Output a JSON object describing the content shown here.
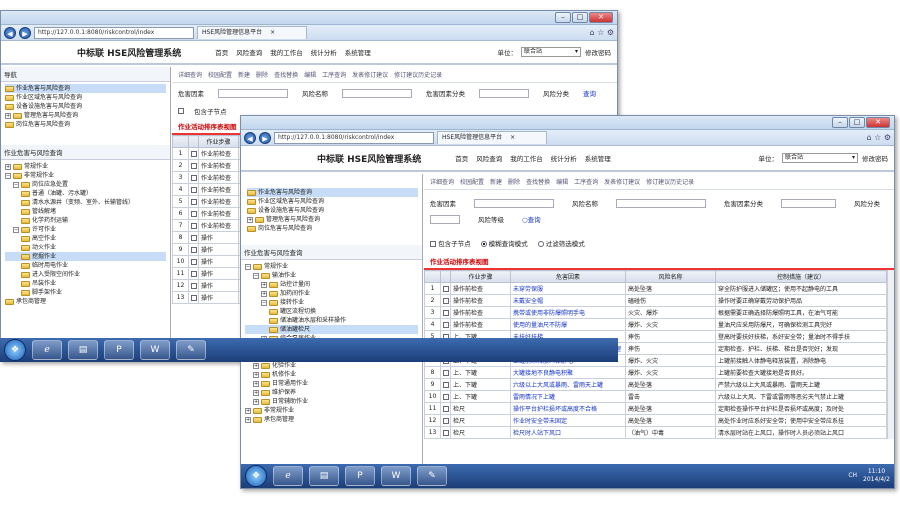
{
  "browser": {
    "url": "http://127.0.0.1:8080/riskcontrol/index",
    "tab_title": "HSE风险管理信息平台",
    "tab_close": "×"
  },
  "app": {
    "logo": "中标联 HSE风险管理系统",
    "menu": [
      "首页",
      "风险查询",
      "我的工作台",
      "统计分析",
      "系统管理"
    ],
    "unit_label": "单位：",
    "unit_value": "联合站",
    "change_pwd": "修改密码"
  },
  "left_header": "导航",
  "tree_top": [
    "作业危害与风险查询",
    "作业区域危害与风险查询",
    "设备设施危害与风险查询",
    "管理危害与风险查询",
    "岗位危害与风险查询"
  ],
  "back_tree": {
    "header": "作业危害与风险查询",
    "nodes": [
      "常规作业",
      "非常规作业",
      "岗位应急处置",
      "普通（油罐、污水罐）",
      "清水水源井（变频、室外、长输管线）",
      "管线解堵",
      "化学药剂运输",
      "许可作业",
      "高空作业",
      "动火作业",
      "挖掘作业",
      "临时用电作业",
      "进入受限空间作业",
      "吊装作业",
      "脚手架作业",
      "承包商管理"
    ]
  },
  "front_tree": {
    "header": "作业危害与风险查询",
    "nodes": [
      "常规作业",
      "输油作业",
      "站控计量间",
      "加药间作业",
      "接转作业",
      "罐区流程切换",
      "储油罐油水层和采样操作",
      "储油罐检尺",
      "综合泵房作业",
      "污水处理作业",
      "注水站作业",
      "化验作业",
      "机修作业",
      "日常通用作业",
      "维护保养",
      "日常辅助作业",
      "非常规作业",
      "承包商管理"
    ]
  },
  "toolbar": [
    "详细查询",
    "校园配置",
    "新建",
    "删除",
    "查找替换",
    "编辑",
    "工序查询",
    "发表修订建议",
    "修订建议历史记录"
  ],
  "form": {
    "f1": "危害因素",
    "f2": "风险名称",
    "f3": "危害因素分类",
    "f4": "风险分类",
    "f5": "风险等级",
    "query": "查询"
  },
  "opts": {
    "include_children": "包含子节点",
    "fuzzy": "模糊查询模式",
    "filter": "过滤筛选模式"
  },
  "section_title": "作业活动排序表视图",
  "table": {
    "headers": [
      "",
      "",
      "作业步骤",
      "危害因素",
      "风险名称",
      "控制措施（建议）"
    ],
    "rows": [
      [
        "1",
        "操作前检查",
        "未穿劳保服",
        "高处坠落",
        "穿全防护服进入储罐区；使用不起静电的工具"
      ],
      [
        "2",
        "操作前检查",
        "未戴安全帽",
        "磕碰伤",
        "操作时要正确穿戴劳动保护用品"
      ],
      [
        "3",
        "操作前检查",
        "携带或使用非防爆照明手电",
        "火灾、爆炸",
        "根据需要正确选择防爆照明工具，在油气可能"
      ],
      [
        "4",
        "操作前检查",
        "使用的量油尺不防爆",
        "爆炸、火灾",
        "量油尺应采用防爆尺，可确保检测工具完好"
      ],
      [
        "5",
        "上、下罐",
        "未扶好扶梯",
        "摔伤",
        "登高时要扶好扶梯，系好安全带；量油时不得手扶"
      ],
      [
        "6",
        "上、下罐",
        "梯台损坏或缺油、霜、水、冰未及时清理",
        "摔伤",
        "定期检查、护栏、扶梯、梯台是否完好；发现"
      ],
      [
        "7",
        "上、下罐",
        "上罐前未释放人体静电",
        "爆炸、火灾",
        "上罐前接触人体静电释放装置，消除静电"
      ],
      [
        "8",
        "上、下罐",
        "大罐接地不良静电积聚",
        "爆炸、火灾",
        "上罐前要检查大罐接地是否良好。"
      ],
      [
        "9",
        "上、下罐",
        "六级以上大风或暴雨、雷雨天上罐",
        "高处坠落",
        "严禁六级以上大风或暴雨、雷雨天上罐"
      ],
      [
        "10",
        "上、下罐",
        "雷雨情况下上罐",
        "雷击",
        "六级以上大风、下雷或雷雨等恶劣天气禁止上罐"
      ],
      [
        "11",
        "检尺",
        "操作平台护栏损坏或高度不合格",
        "高处坠落",
        "定期检查操作平台护栏是否损坏或高度；及时处"
      ],
      [
        "12",
        "检尺",
        "作业时安全带未固定",
        "高处坠落",
        "高处作业时应系好安全带；使用中安全带应系挂"
      ],
      [
        "13",
        "检尺",
        "检尺时人站下风口",
        "（油气）中毒",
        "清水层时站在上风口，操作时人员必须站上风口"
      ]
    ]
  },
  "back_rows": [
    "1",
    "2",
    "3",
    "4",
    "5",
    "6",
    "7",
    "8",
    "9",
    "10",
    "11",
    "12",
    "13"
  ],
  "back_row_labels": [
    "作业前检查",
    "作业前检查",
    "作业前检查",
    "作业前检查",
    "作业前检查",
    "作业前检查",
    "作业前检查",
    "操作",
    "操作",
    "操作",
    "操作",
    "操作",
    "操作"
  ],
  "taskbar": {
    "time": "11:10",
    "date": "2014/4/2",
    "lang": "CH"
  },
  "colors": {
    "accent": "#1434c8",
    "section": "#cc0000"
  }
}
